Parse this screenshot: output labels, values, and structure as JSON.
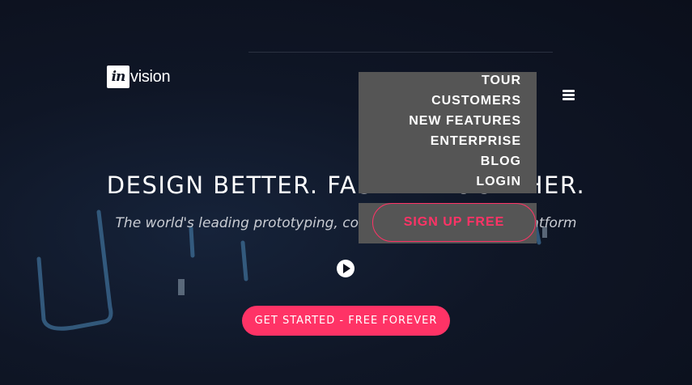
{
  "brand": {
    "logo_mark": "in",
    "logo_word": "vision",
    "accent": "#ff3366"
  },
  "nav": {
    "items": [
      {
        "label": "TOUR"
      },
      {
        "label": "CUSTOMERS"
      },
      {
        "label": "NEW FEATURES"
      },
      {
        "label": "ENTERPRISE"
      },
      {
        "label": "BLOG"
      },
      {
        "label": "LOGIN"
      }
    ],
    "signup_label": "SIGN UP FREE",
    "menu_icon": "hamburger-icon"
  },
  "hero": {
    "headline": "DESIGN BETTER. FASTER. TOGETHER.",
    "tagline": "The world's leading prototyping, collaboration & workflow platform",
    "play_icon": "play-icon",
    "cta_label": "GET STARTED - FREE FOREVER"
  }
}
